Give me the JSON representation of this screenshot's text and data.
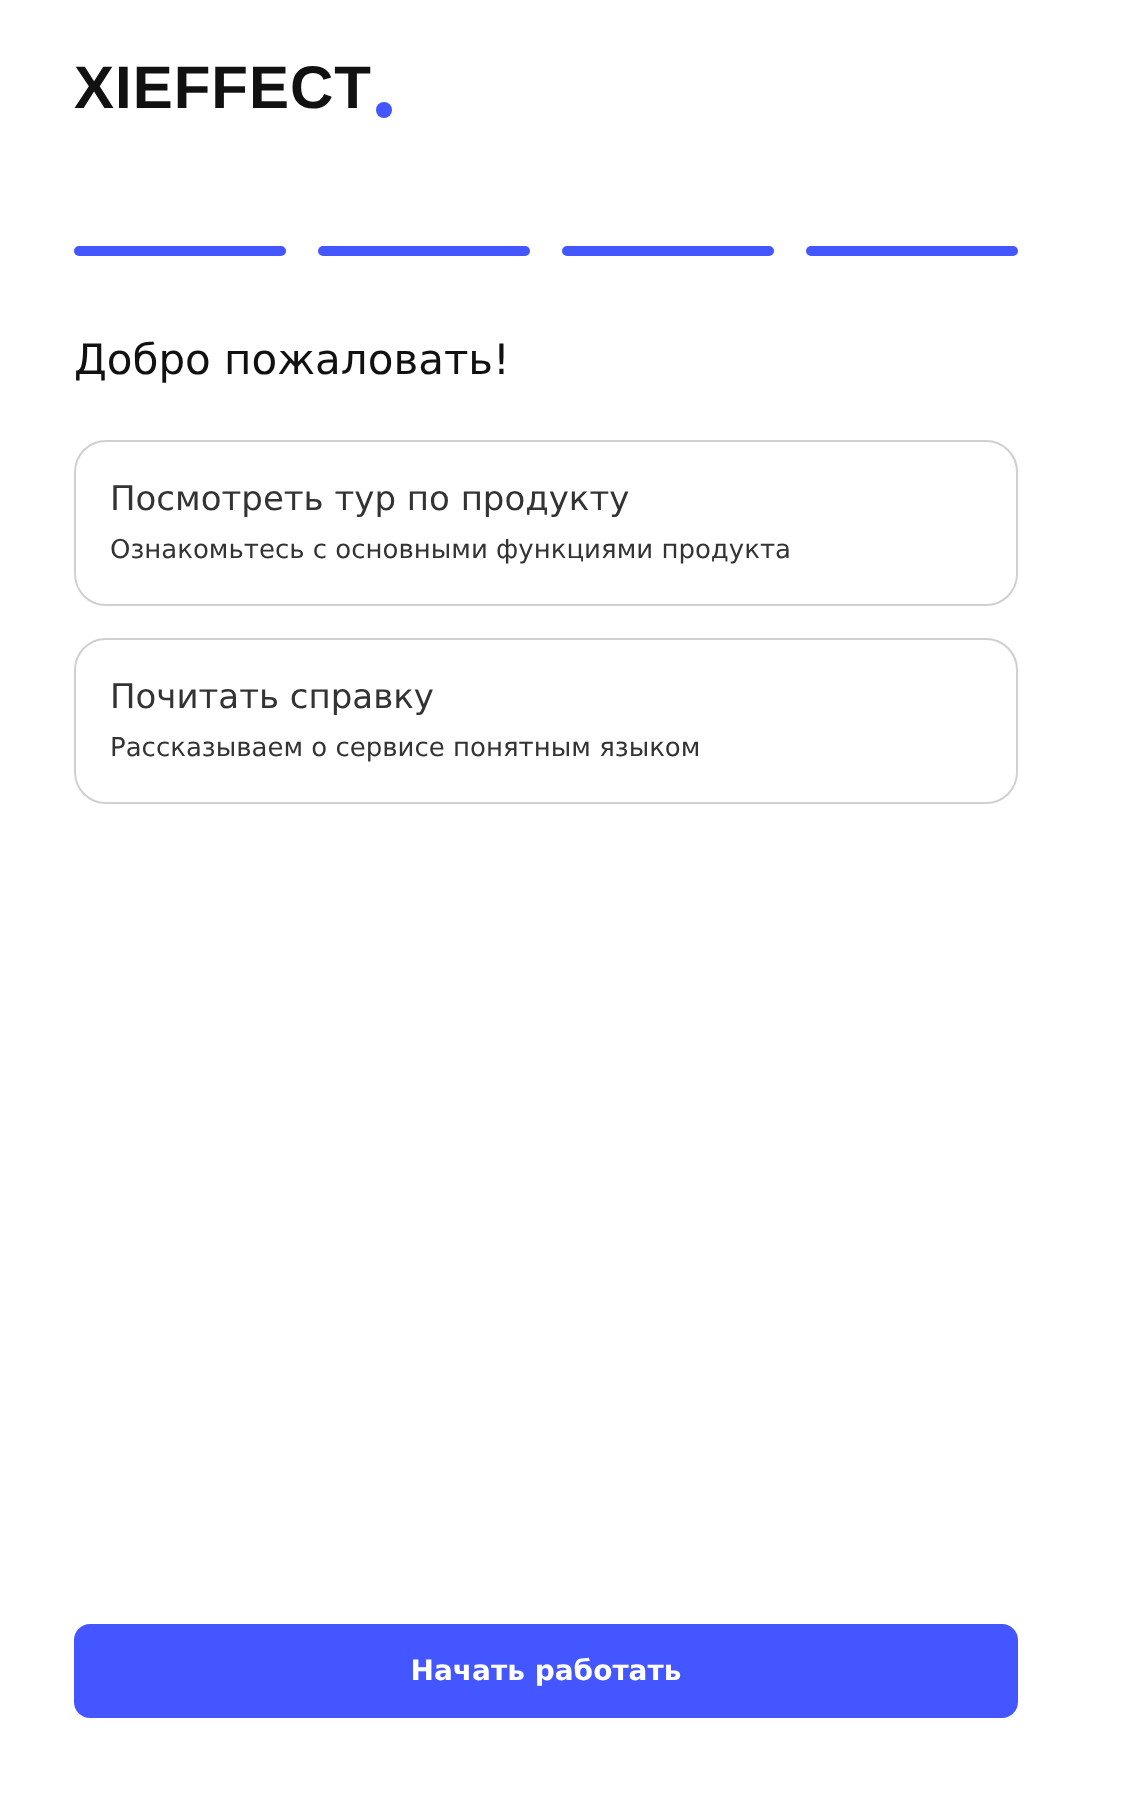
{
  "logo": {
    "text": "XIEFFECT"
  },
  "steps": [
    {
      "completed": true
    },
    {
      "completed": true
    },
    {
      "completed": true
    },
    {
      "completed": true
    }
  ],
  "title": "Добро пожаловать!",
  "cards": [
    {
      "title": "Посмотреть тур по продукту",
      "description": "Ознакомьтесь с основными функциями продукта"
    },
    {
      "title": "Почитать справку",
      "description": "Рассказываем о сервисе понятным языком"
    }
  ],
  "button": "Начать работать"
}
